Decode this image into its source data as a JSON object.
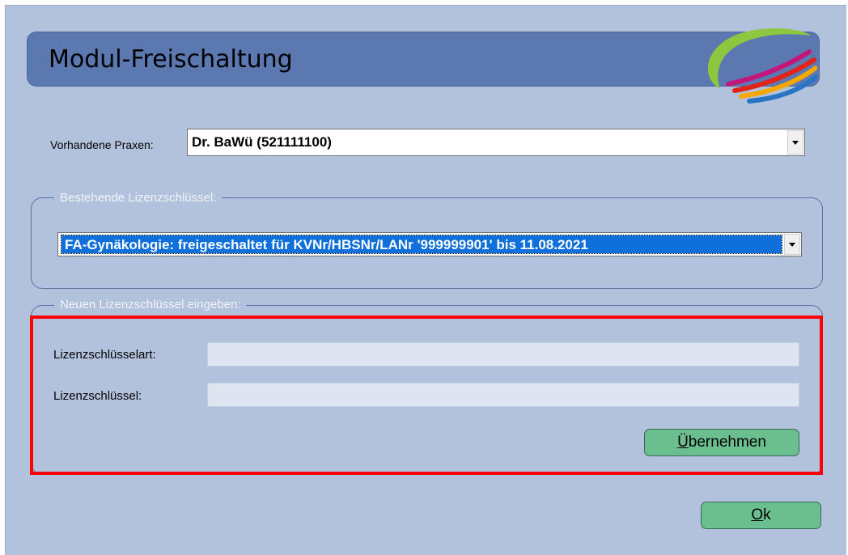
{
  "header": {
    "title": "Modul-Freischaltung",
    "logo_icon": "app-logo-swoosh-icon"
  },
  "praxis": {
    "label": "Vorhandene Praxen:",
    "selected": "Dr. BaWü (521111100)"
  },
  "existing_keys": {
    "legend": "Bestehende Lizenzschlüssel:",
    "selected": "FA-Gynäkologie: freigeschaltet für KVNr/HBSNr/LANr '999999901' bis 11.08.2021"
  },
  "new_key": {
    "legend": "Neuen Lizenzschlüssel eingeben:",
    "type_label": "Lizenzschlüsselart:",
    "type_value": "",
    "key_label": "Lizenzschlüssel:",
    "key_value": "",
    "apply_button": {
      "mnemonic": "Ü",
      "rest": "bernehmen"
    }
  },
  "footer": {
    "ok_button": {
      "mnemonic": "O",
      "rest": "k"
    }
  },
  "colors": {
    "window_bg": "#b2c2dd",
    "title_bg": "#5b79b0",
    "selection": "#0f70db",
    "button_green": "#6bbf8f",
    "highlight_red": "#ff0000"
  }
}
